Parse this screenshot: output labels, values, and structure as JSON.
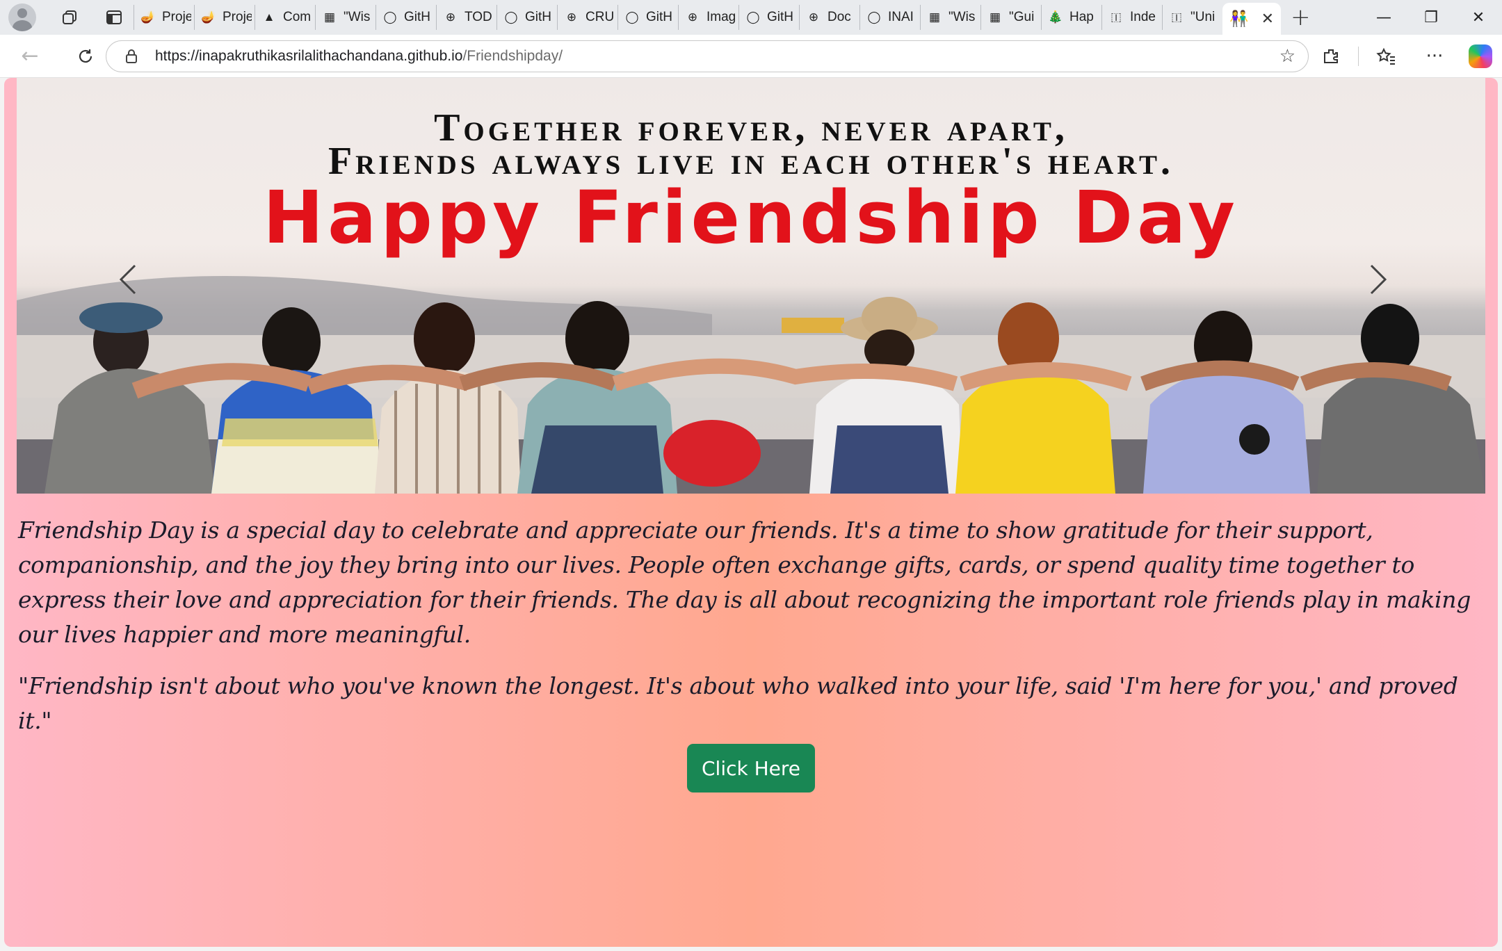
{
  "browser": {
    "tabs": [
      {
        "title": "Proje",
        "icon": "lamp-icon"
      },
      {
        "title": "Proje",
        "icon": "lamp-icon"
      },
      {
        "title": "Com",
        "icon": "drive-icon"
      },
      {
        "title": "\"Wis",
        "icon": "image-icon"
      },
      {
        "title": "GitH",
        "icon": "github-icon"
      },
      {
        "title": "TOD",
        "icon": "globe-icon"
      },
      {
        "title": "GitH",
        "icon": "github-icon"
      },
      {
        "title": "CRU",
        "icon": "globe-icon"
      },
      {
        "title": "GitH",
        "icon": "github-icon"
      },
      {
        "title": "Imag",
        "icon": "globe-icon"
      },
      {
        "title": "GitH",
        "icon": "github-icon"
      },
      {
        "title": "Doc",
        "icon": "globe-icon"
      },
      {
        "title": "INAI",
        "icon": "github-icon"
      },
      {
        "title": "\"Wis",
        "icon": "image-icon"
      },
      {
        "title": "\"Gui",
        "icon": "image-icon"
      },
      {
        "title": "Hap",
        "icon": "tree-icon"
      },
      {
        "title": "Inde",
        "icon": "india-flag-icon"
      },
      {
        "title": "\"Uni",
        "icon": "india-flag-icon"
      }
    ],
    "active_tab_icon": "couple-icon",
    "url_host": "https://inapakruthikasrilalithachandana.github.io",
    "url_path": "/Friendshipday/"
  },
  "banner": {
    "line1": "Together forever, never apart,",
    "line2": "Friends always live in each other's heart.",
    "headline": "Happy Friendship Day"
  },
  "content": {
    "paragraph": "Friendship Day is a special day to celebrate and appreciate our friends. It's a time to show gratitude for their support, companionship, and the joy they bring into our lives. People often exchange gifts, cards, or spend quality time together to express their love and appreciation for their friends. The day is all about recognizing the important role friends play in making our lives happier and more meaningful.",
    "quote": "\"Friendship isn't about who you've known the longest. It's about who walked into your life, said 'I'm here for you,' and proved it.\"",
    "button_label": "Click Here"
  },
  "colors": {
    "headline": "#e2121a",
    "button": "#198754",
    "gradient_edge": "#ffb7c5",
    "gradient_center": "#ffa88f"
  }
}
